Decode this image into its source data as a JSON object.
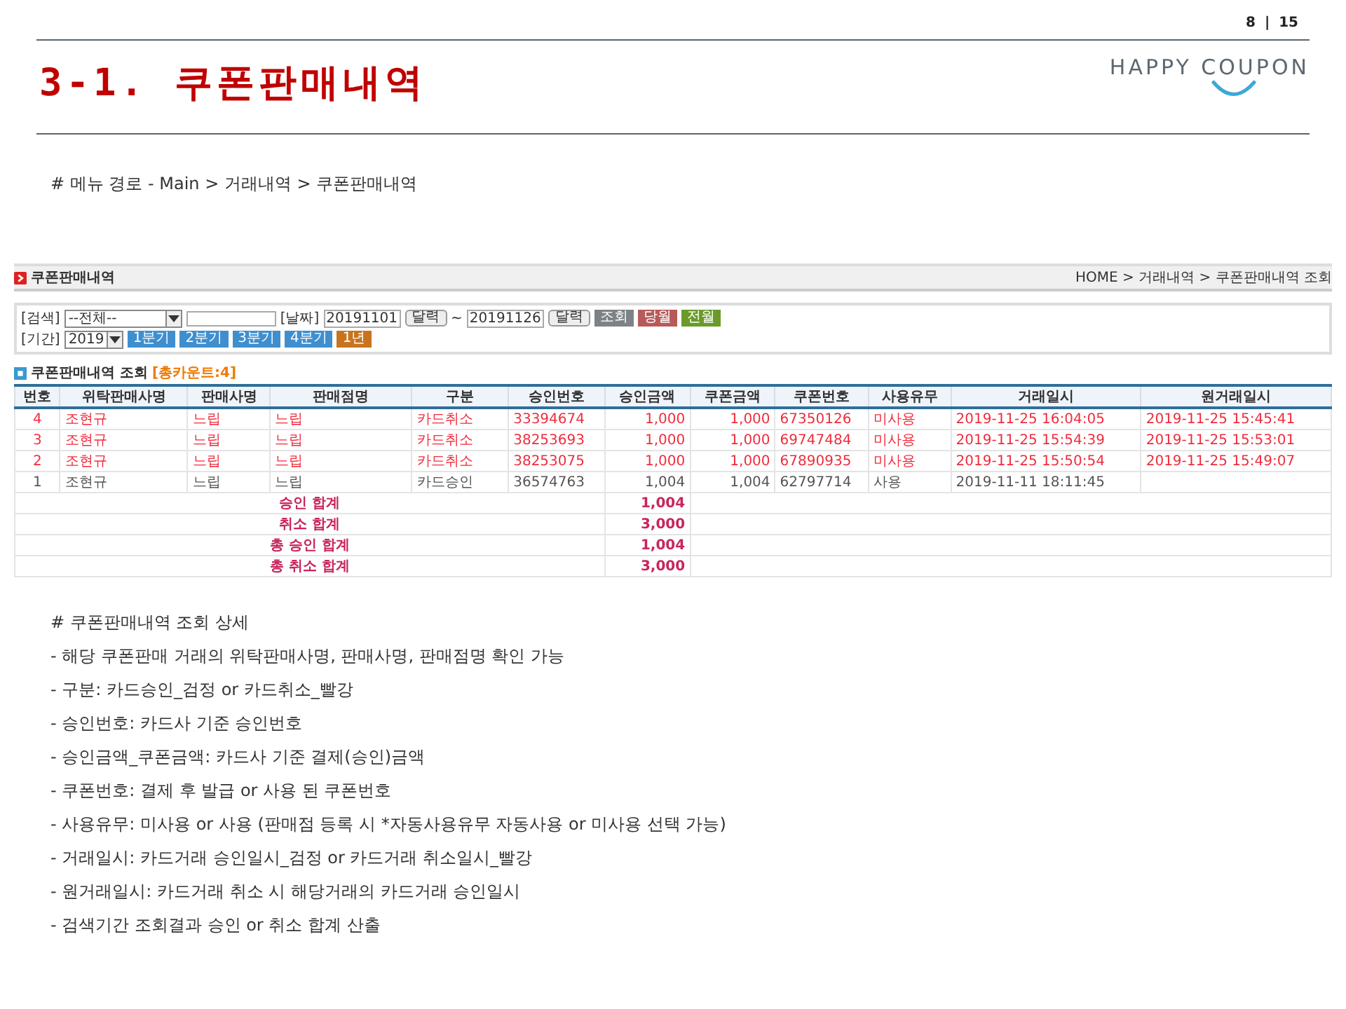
{
  "page_number": {
    "current": "8",
    "separator": "|",
    "total": "15"
  },
  "title": "3-1. 쿠폰판매내역",
  "logo": {
    "text": "HAPPY COUPON"
  },
  "menu_path": "# 메뉴 경로 - Main > 거래내역 > 쿠폰판매내역",
  "screen": {
    "title": "쿠폰판매내역",
    "breadcrumb": "HOME > 거래내역 > 쿠폰판매내역 조회",
    "search": {
      "search_label": "[검색]",
      "select_value": "--전체--",
      "date_label": "[날짜]",
      "date_from": "20191101",
      "calendar_button": "달력",
      "tilde": "~",
      "date_to": "20191126",
      "calendar_button_2": "달력",
      "buttons": [
        {
          "label": "조회",
          "color": "#7d8287"
        },
        {
          "label": "당월",
          "color": "#b85a5a"
        },
        {
          "label": "전월",
          "color": "#6b9a2a"
        }
      ],
      "period_label": "[기간]",
      "year_value": "2019",
      "period_buttons": [
        {
          "label": "1분기",
          "color": "#3f8fcf"
        },
        {
          "label": "2분기",
          "color": "#3f8fcf"
        },
        {
          "label": "3분기",
          "color": "#3f8fcf"
        },
        {
          "label": "4분기",
          "color": "#3f8fcf"
        },
        {
          "label": "1년",
          "color": "#c8741f"
        }
      ]
    },
    "result_caption": "쿠폰판매내역 조회",
    "result_count": "[총카운트:4]",
    "table": {
      "columns": [
        "번호",
        "위탁판매사명",
        "판매사명",
        "판매점명",
        "구분",
        "승인번호",
        "승인금액",
        "쿠폰금액",
        "쿠폰번호",
        "사용유무",
        "거래일시",
        "원거래일시"
      ],
      "rows": [
        {
          "cancelled": true,
          "cells": [
            "4",
            "조현규",
            "느립",
            "느립",
            "카드취소",
            "33394674",
            "1,000",
            "1,000",
            "67350126",
            "미사용",
            "2019-11-25 16:04:05",
            "2019-11-25 15:45:41"
          ]
        },
        {
          "cancelled": true,
          "cells": [
            "3",
            "조현규",
            "느립",
            "느립",
            "카드취소",
            "38253693",
            "1,000",
            "1,000",
            "69747484",
            "미사용",
            "2019-11-25 15:54:39",
            "2019-11-25 15:53:01"
          ]
        },
        {
          "cancelled": true,
          "cells": [
            "2",
            "조현규",
            "느립",
            "느립",
            "카드취소",
            "38253075",
            "1,000",
            "1,000",
            "67890935",
            "미사용",
            "2019-11-25 15:50:54",
            "2019-11-25 15:49:07"
          ]
        },
        {
          "cancelled": false,
          "cells": [
            "1",
            "조현규",
            "느립",
            "느립",
            "카드승인",
            "36574763",
            "1,004",
            "1,004",
            "62797714",
            "사용",
            "2019-11-11 18:11:45",
            null
          ]
        }
      ],
      "totals": [
        {
          "label": "승인 합계",
          "value": "1,004"
        },
        {
          "label": "취소 합계",
          "value": "3,000"
        },
        {
          "label": "총 승인 합계",
          "value": "1,004"
        },
        {
          "label": "총 취소 합계",
          "value": "3,000"
        }
      ]
    }
  },
  "details": {
    "heading": "# 쿠폰판매내역 조회 상세",
    "lines": [
      "- 해당 쿠폰판매 거래의 위탁판매사명, 판매사명, 판매점명 확인 가능",
      "- 구분: 카드승인_검정 or 카드취소_빨강",
      "- 승인번호: 카드사 기준 승인번호",
      "- 승인금액_쿠폰금액: 카드사 기준 결제(승인)금액",
      "- 쿠폰번호: 결제 후 발급 or 사용 된 쿠폰번호",
      "- 사용유무: 미사용 or 사용 (판매점 등록 시 *자동사용유무 자동사용 or 미사용 선택 가능)",
      "- 거래일시: 카드거래 승인일시_검정 or 카드거래 취소일시_빨강",
      "- 원거래일시: 카드거래 취소 시 해당거래의 카드거래 승인일시",
      "- 검색기간 조회결과 승인 or 취소 합계 산출"
    ]
  }
}
